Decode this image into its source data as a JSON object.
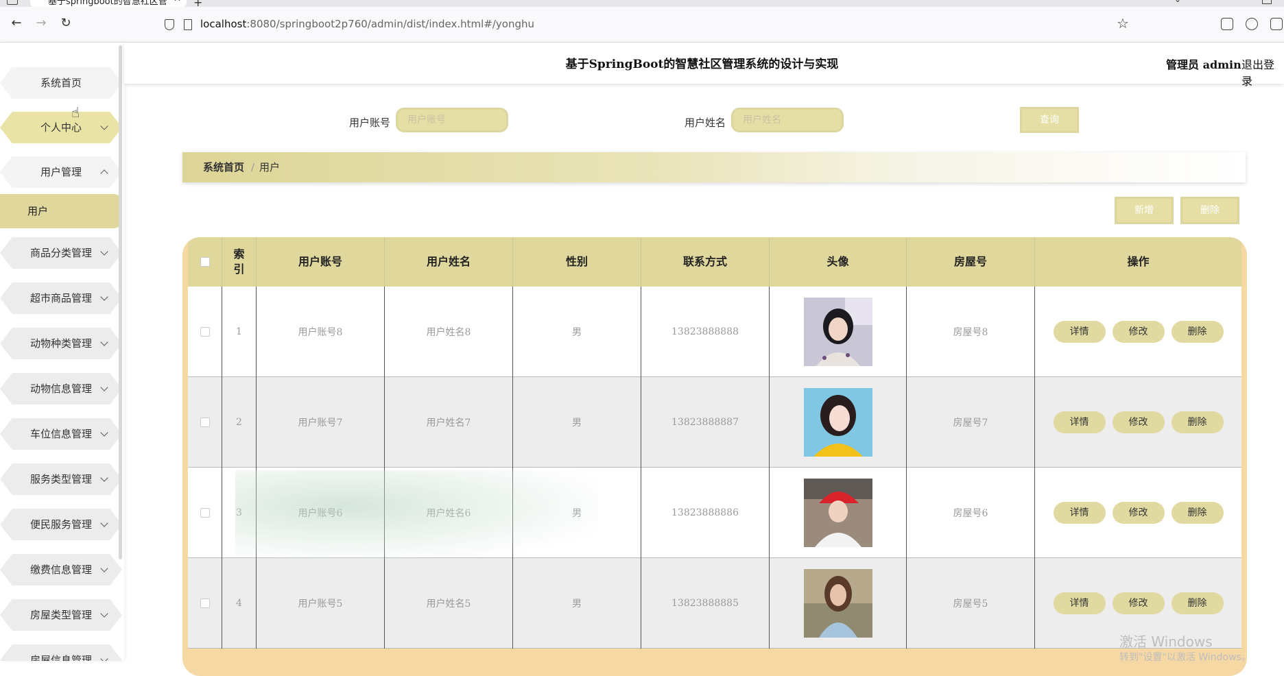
{
  "browser": {
    "tab_title": "基于springboot的智慧社区管",
    "url_host": "localhost",
    "url_path": ":8080/springboot2p760/admin/dist/index.html#/yonghu"
  },
  "header": {
    "title": "基于SpringBoot的智慧社区管理系统的设计与实现",
    "user": "管理员 admin",
    "logout": "退出登录"
  },
  "sidebar": {
    "items": [
      {
        "label": "系统首页"
      },
      {
        "label": "个人中心"
      },
      {
        "label": "用户管理"
      },
      {
        "label": "商品分类管理"
      },
      {
        "label": "超市商品管理"
      },
      {
        "label": "动物种类管理"
      },
      {
        "label": "动物信息管理"
      },
      {
        "label": "车位信息管理"
      },
      {
        "label": "服务类型管理"
      },
      {
        "label": "便民服务管理"
      },
      {
        "label": "缴费信息管理"
      },
      {
        "label": "房屋类型管理"
      },
      {
        "label": "房屋信息管理"
      }
    ],
    "sub_item": "用户"
  },
  "search": {
    "account_label": "用户账号",
    "account_placeholder": "用户账号",
    "name_label": "用户姓名",
    "name_placeholder": "用户姓名",
    "button": "查询"
  },
  "breadcrumb": {
    "home": "系统首页",
    "sep": "/",
    "current": "用户"
  },
  "actions": {
    "add": "新增",
    "delete": "删除"
  },
  "table": {
    "headers": [
      "索\n引",
      "用户账号",
      "用户姓名",
      "性别",
      "联系方式",
      "头像",
      "房屋号",
      "操作"
    ],
    "rows": [
      {
        "index": "1",
        "account": "用户账号8",
        "name": "用户姓名8",
        "gender": "男",
        "phone": "13823888888",
        "house": "房屋号8"
      },
      {
        "index": "2",
        "account": "用户账号7",
        "name": "用户姓名7",
        "gender": "男",
        "phone": "13823888887",
        "house": "房屋号7"
      },
      {
        "index": "3",
        "account": "用户账号6",
        "name": "用户姓名6",
        "gender": "男",
        "phone": "13823888886",
        "house": "房屋号6"
      },
      {
        "index": "4",
        "account": "用户账号5",
        "name": "用户姓名5",
        "gender": "男",
        "phone": "13823888885",
        "house": "房屋号5"
      }
    ],
    "ops": {
      "detail": "详情",
      "edit": "修改",
      "remove": "删除"
    }
  },
  "watermark": {
    "line1": "激活 Windows",
    "line2": "转到\"设置\"以激活 Windows。"
  }
}
